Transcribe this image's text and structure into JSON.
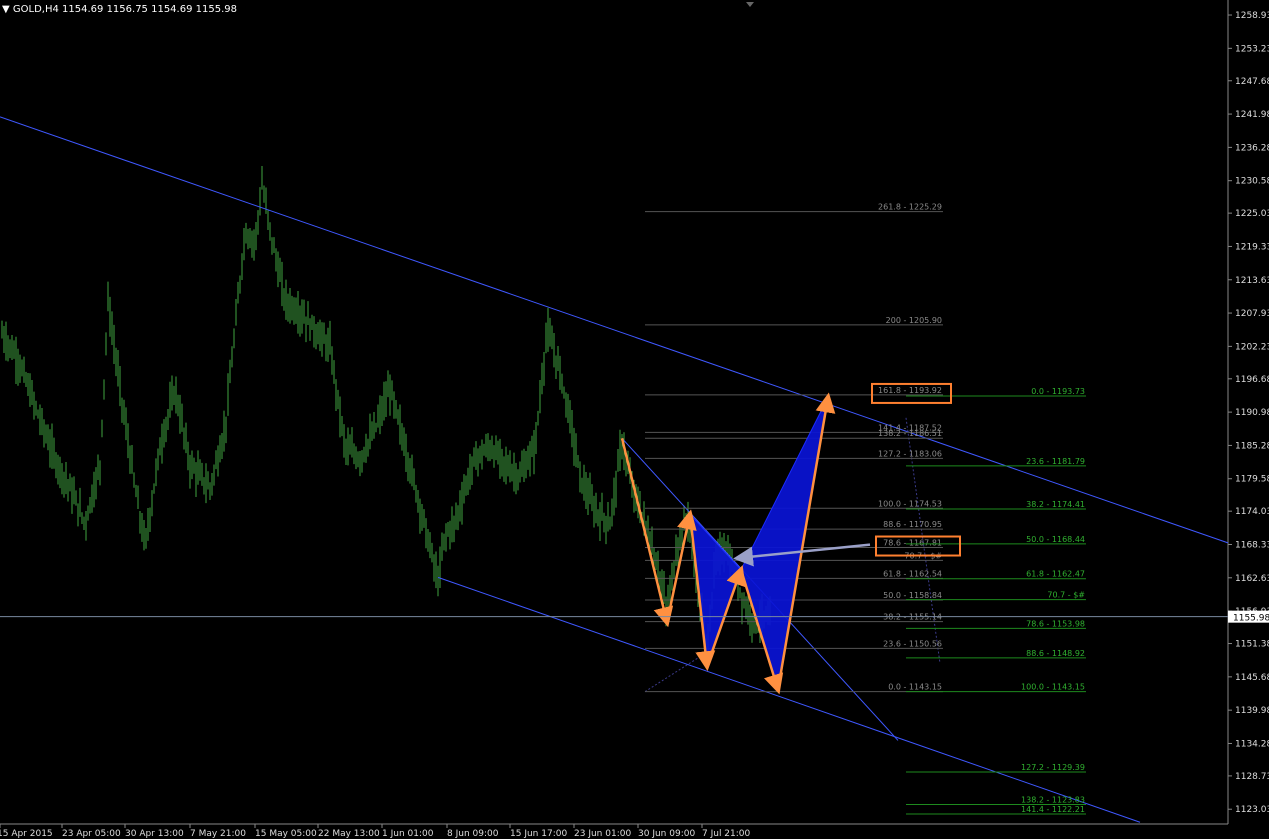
{
  "header": {
    "symbol": "GOLD,H4",
    "ohlc": "1154.69 1156.75 1154.69 1155.98"
  },
  "colors": {
    "background": "#000000",
    "candles": "#3fa53f",
    "channel": "#3f58ff",
    "pattern_fill": "#0a14d6",
    "arrows": "#ff9040",
    "fib_left": "#9a9a9a",
    "fib_right": "#30b030",
    "highlight_box": "#ff8030",
    "current_price": "#000000"
  },
  "chart_data": {
    "type": "candlestick",
    "symbol": "GOLD",
    "timeframe": "H4",
    "ylim": [
      1120.5,
      1261.5
    ],
    "y_ticks": [
      "1258.93",
      "1253.23",
      "1247.68",
      "1241.98",
      "1236.28",
      "1230.58",
      "1225.03",
      "1219.33",
      "1213.63",
      "1207.93",
      "1202.23",
      "1196.68",
      "1190.98",
      "1185.28",
      "1179.58",
      "1174.03",
      "1168.33",
      "1162.63",
      "1156.93",
      "1151.38",
      "1145.68",
      "1139.98",
      "1134.28",
      "1128.73",
      "1123.03"
    ],
    "x_ticks": [
      "15 Apr 2015",
      "23 Apr 05:00",
      "30 Apr 13:00",
      "7 May 21:00",
      "15 May 05:00",
      "22 May 13:00",
      "1 Jun 01:00",
      "8 Jun 09:00",
      "15 Jun 17:00",
      "23 Jun 01:00",
      "30 Jun 09:00",
      "7 Jul 21:00"
    ],
    "current_price": "1155.98",
    "price_path": [
      [
        0,
        1205
      ],
      [
        18,
        1200
      ],
      [
        35,
        1192
      ],
      [
        55,
        1183
      ],
      [
        70,
        1178
      ],
      [
        85,
        1172
      ],
      [
        100,
        1182
      ],
      [
        108,
        1210
      ],
      [
        120,
        1195
      ],
      [
        135,
        1178
      ],
      [
        145,
        1168
      ],
      [
        160,
        1185
      ],
      [
        175,
        1195
      ],
      [
        190,
        1182
      ],
      [
        210,
        1178
      ],
      [
        225,
        1188
      ],
      [
        235,
        1205
      ],
      [
        245,
        1222
      ],
      [
        255,
        1220
      ],
      [
        262,
        1230
      ],
      [
        270,
        1222
      ],
      [
        285,
        1210
      ],
      [
        300,
        1208
      ],
      [
        315,
        1205
      ],
      [
        330,
        1202
      ],
      [
        345,
        1185
      ],
      [
        360,
        1183
      ],
      [
        375,
        1188
      ],
      [
        390,
        1195
      ],
      [
        405,
        1185
      ],
      [
        420,
        1175
      ],
      [
        438,
        1162
      ],
      [
        445,
        1170
      ],
      [
        455,
        1172
      ],
      [
        465,
        1178
      ],
      [
        475,
        1183
      ],
      [
        490,
        1185
      ],
      [
        505,
        1182
      ],
      [
        520,
        1180
      ],
      [
        535,
        1185
      ],
      [
        547,
        1205
      ],
      [
        560,
        1198
      ],
      [
        570,
        1190
      ],
      [
        580,
        1180
      ],
      [
        595,
        1174
      ],
      [
        610,
        1172
      ],
      [
        622,
        1186
      ],
      [
        632,
        1178
      ],
      [
        645,
        1172
      ],
      [
        657,
        1165
      ],
      [
        667,
        1157
      ],
      [
        677,
        1168
      ],
      [
        688,
        1173
      ],
      [
        697,
        1162
      ],
      [
        707,
        1150
      ],
      [
        715,
        1165
      ],
      [
        725,
        1168
      ],
      [
        735,
        1163
      ],
      [
        745,
        1158
      ],
      [
        755,
        1155
      ],
      [
        765,
        1156
      ],
      [
        770,
        1155
      ]
    ],
    "channel_lines": [
      {
        "p1": [
          0,
          1241.5
        ],
        "p2": [
          1228,
          1168.6
        ]
      },
      {
        "p1": [
          438,
          1162.7
        ],
        "p2": [
          1140,
          1120.8
        ]
      }
    ],
    "fib_left": {
      "x_range": [
        645,
        943
      ],
      "levels": [
        {
          "label": "261.8 - 1225.29",
          "price": 1225.29
        },
        {
          "label": "200 - 1205.90",
          "price": 1205.9
        },
        {
          "label": "161.8 - 1193.92",
          "price": 1193.92
        },
        {
          "label": "141.4 - 1187.52",
          "price": 1187.52
        },
        {
          "label": "138.2 - 1186.51",
          "price": 1186.51
        },
        {
          "label": "127.2 - 1183.06",
          "price": 1183.06
        },
        {
          "label": "100.0 - 1174.53",
          "price": 1174.53
        },
        {
          "label": "88.6 - 1170.95",
          "price": 1170.95
        },
        {
          "label": "78.6 - 1167.81",
          "price": 1167.81
        },
        {
          "label": "70.7 - $#",
          "price": 1165.6
        },
        {
          "label": "61.8 - 1162.54",
          "price": 1162.54
        },
        {
          "label": "50.0 - 1158.84",
          "price": 1158.84
        },
        {
          "label": "38.2 - 1155.14",
          "price": 1155.14
        },
        {
          "label": "23.6 - 1150.56",
          "price": 1150.56
        },
        {
          "label": "0.0 - 1143.15",
          "price": 1143.15
        }
      ]
    },
    "fib_right": {
      "x_range": [
        906,
        1086
      ],
      "levels": [
        {
          "label": "0.0 - 1193.73",
          "price": 1193.73
        },
        {
          "label": "23.6 - 1181.79",
          "price": 1181.79
        },
        {
          "label": "38.2 - 1174.41",
          "price": 1174.41
        },
        {
          "label": "50.0 - 1168.44",
          "price": 1168.44
        },
        {
          "label": "61.8 - 1162.47",
          "price": 1162.47
        },
        {
          "label": "70.7 - $#",
          "price": 1158.9
        },
        {
          "label": "78.6 - 1153.98",
          "price": 1153.98
        },
        {
          "label": "88.6 - 1148.92",
          "price": 1148.92
        },
        {
          "label": "100.0 - 1143.15",
          "price": 1143.15
        },
        {
          "label": "127.2 - 1129.39",
          "price": 1129.39
        },
        {
          "label": "138.2 - 1123.83",
          "price": 1123.83
        },
        {
          "label": "141.4 - 1122.21",
          "price": 1122.21
        }
      ]
    },
    "pattern_arrows": [
      [
        [
          622,
          1186.5
        ],
        [
          667,
          1155
        ]
      ],
      [
        [
          667,
          1155
        ],
        [
          690,
          1173.5
        ]
      ],
      [
        [
          690,
          1173.5
        ],
        [
          707,
          1147.5
        ]
      ],
      [
        [
          707,
          1147.5
        ],
        [
          741,
          1164
        ]
      ],
      [
        [
          741,
          1164
        ],
        [
          778,
          1143.5
        ]
      ],
      [
        [
          778,
          1143.5
        ],
        [
          828,
          1193.5
        ]
      ]
    ],
    "pattern_fill_triangles": [
      [
        [
          690,
          1173.5
        ],
        [
          707,
          1147.5
        ],
        [
          741,
          1164
        ]
      ],
      [
        [
          741,
          1164
        ],
        [
          778,
          1143.5
        ],
        [
          828,
          1193.5
        ]
      ]
    ],
    "highlights": [
      {
        "price": 1193.92,
        "x": [
          872,
          951
        ]
      },
      {
        "price": 1167.81,
        "x": [
          876,
          960
        ]
      }
    ],
    "pointer_arrow": {
      "from": [
        870,
        1168.3
      ],
      "to": [
        738,
        1166.0
      ]
    }
  }
}
